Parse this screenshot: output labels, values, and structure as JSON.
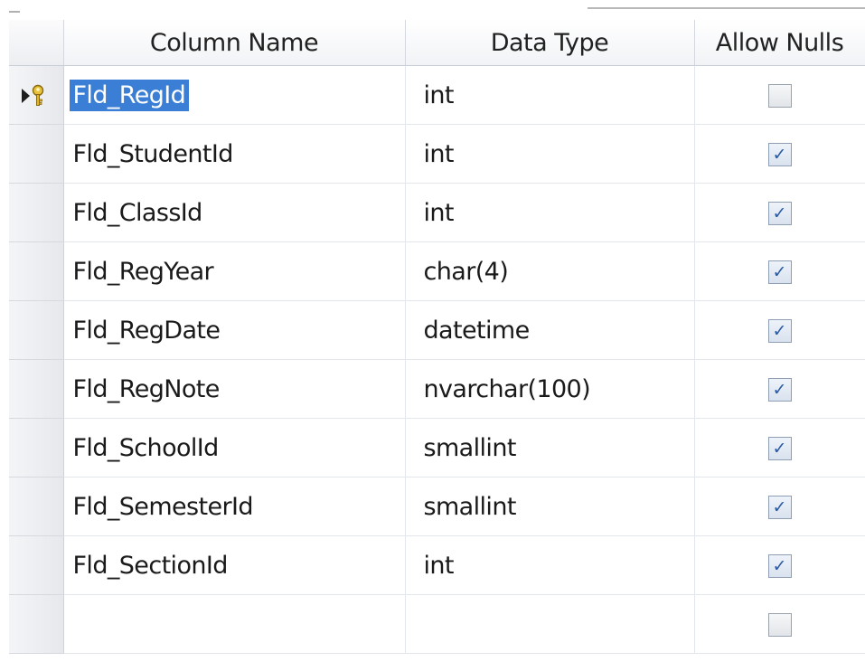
{
  "grid": {
    "headers": {
      "column_name": "Column Name",
      "data_type": "Data Type",
      "allow_nulls": "Allow Nulls"
    },
    "rows": [
      {
        "name": "Fld_RegId",
        "type": "int",
        "allow_nulls": false,
        "primary_key": true,
        "selected": true
      },
      {
        "name": "Fld_StudentId",
        "type": "int",
        "allow_nulls": true
      },
      {
        "name": "Fld_ClassId",
        "type": "int",
        "allow_nulls": true
      },
      {
        "name": "Fld_RegYear",
        "type": "char(4)",
        "allow_nulls": true
      },
      {
        "name": "Fld_RegDate",
        "type": "datetime",
        "allow_nulls": true
      },
      {
        "name": "Fld_RegNote",
        "type": "nvarchar(100)",
        "allow_nulls": true
      },
      {
        "name": "Fld_SchoolId",
        "type": "smallint",
        "allow_nulls": true
      },
      {
        "name": "Fld_SemesterId",
        "type": "smallint",
        "allow_nulls": true
      },
      {
        "name": "Fld_SectionId",
        "type": "int",
        "allow_nulls": true
      },
      {
        "name": "",
        "type": "",
        "allow_nulls": false
      }
    ],
    "check_glyph": "✓"
  },
  "colors": {
    "selection": "#3a7fd5",
    "check": "#2a5aa0"
  },
  "icons": {
    "row_marker": "current-row-arrow-icon",
    "primary_key": "primary-key-icon"
  }
}
